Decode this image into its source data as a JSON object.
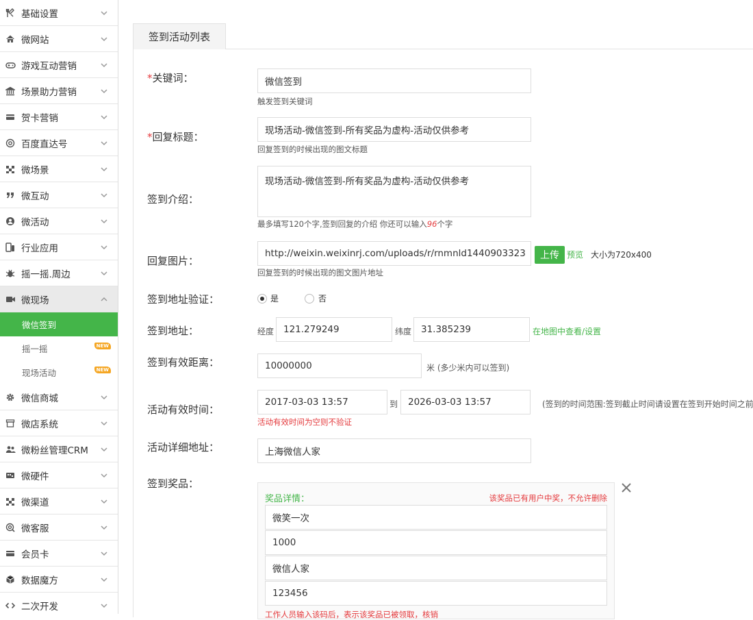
{
  "sidebar": {
    "items": [
      {
        "label": "基础设置",
        "icon": "tools-icon"
      },
      {
        "label": "微网站",
        "icon": "home-icon"
      },
      {
        "label": "游戏互动营销",
        "icon": "gamepad-icon"
      },
      {
        "label": "场景助力营销",
        "icon": "bank-icon"
      },
      {
        "label": "贺卡营销",
        "icon": "card-icon"
      },
      {
        "label": "百度直达号",
        "icon": "at-icon"
      },
      {
        "label": "微场景",
        "icon": "cubes-icon"
      },
      {
        "label": "微互动",
        "icon": "quote-icon"
      },
      {
        "label": "微活动",
        "icon": "user-circle-icon"
      },
      {
        "label": "行业应用",
        "icon": "phone-tablet-icon"
      },
      {
        "label": "摇一摇.周边",
        "icon": "bug-icon"
      },
      {
        "label": "微现场",
        "icon": "video-icon",
        "open": true
      }
    ],
    "sub_items": [
      {
        "label": "微信签到",
        "active": true
      },
      {
        "label": "摇一摇",
        "badge": "NEW"
      },
      {
        "label": "现场活动",
        "badge": "NEW"
      }
    ],
    "items_after": [
      {
        "label": "微信商城",
        "icon": "gear-icon"
      },
      {
        "label": "微店系统",
        "icon": "shop-icon"
      },
      {
        "label": "微粉丝管理CRM",
        "icon": "users-icon"
      },
      {
        "label": "微硬件",
        "icon": "hardware-icon"
      },
      {
        "label": "微渠道",
        "icon": "cubes-icon"
      },
      {
        "label": "微客服",
        "icon": "support-icon"
      },
      {
        "label": "会员卡",
        "icon": "card-icon"
      },
      {
        "label": "数据魔方",
        "icon": "cube-icon"
      },
      {
        "label": "二次开发",
        "icon": "code-icon"
      }
    ]
  },
  "tab": {
    "label": "签到活动列表"
  },
  "form": {
    "keyword_label": "关键词：",
    "keyword_value": "微信签到",
    "keyword_hint": "触发签到关键词",
    "title_label": "回复标题：",
    "title_value": "现场活动-微信签到-所有奖品为虚构-活动仅供参考",
    "title_hint": "回复签到的时候出现的图文标题",
    "intro_label": "签到介绍：",
    "intro_value": "现场活动-微信签到-所有奖品为虚构-活动仅供参考",
    "intro_hint_pre": "最多填写120个字,签到回复的介绍 你还可以输入",
    "intro_hint_num": "96",
    "intro_hint_post": "个字",
    "image_label": "回复图片：",
    "image_value": "http://weixin.weixinrj.com/uploads/r/rnmnld1440903323",
    "upload_label": "上传",
    "preview_label": "预览",
    "size_hint": "大小为720x400",
    "image_hint": "回复签到的时候出现的图文图片地址",
    "verify_label": "签到地址验证：",
    "yes_label": "是",
    "no_label": "否",
    "verify_value": "是",
    "addr_label": "签到地址：",
    "lng_label": "经度",
    "lng_value": "121.279249",
    "lat_label": "纬度",
    "lat_value": "31.385239",
    "map_link": "在地图中查看/设置",
    "dist_label": "签到有效距离：",
    "dist_value": "10000000",
    "dist_hint": "米 (多少米内可以签到)",
    "time_label": "活动有效时间：",
    "time_start": "2017-03-03 13:57",
    "time_to": "到",
    "time_end": "2026-03-03 13:57",
    "time_hint": "(签到的时间范围:签到截止时间请设置在签到开始时间之前)",
    "time_warn": "活动有效时间为空则不验证",
    "detail_addr_label": "活动详细地址：",
    "detail_addr_value": "上海微信人家",
    "prize_label": "签到奖品：",
    "prize_title": "奖品详情：",
    "prize_warn": "该奖品已有用户中奖，不允许删除",
    "prize_name": "微笑一次",
    "prize_count": "1000",
    "prize_provider": "微信人家",
    "prize_code": "123456",
    "prize_code_hint": "工作人员输入该码后，表示该奖品已被领取，核销"
  },
  "colors": {
    "accent": "#44b549",
    "required": "#e4393c",
    "badge": "#f5a623"
  }
}
